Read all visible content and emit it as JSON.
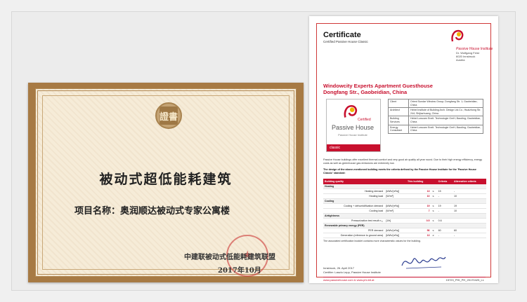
{
  "cn_certificate": {
    "seal_char": "證書",
    "title": "被动式超低能耗建筑",
    "project": "项目名称：奥润顺达被动式专家公寓楼",
    "issuer": "中建联被动式低能耗建筑联盟",
    "date": "2017年10月"
  },
  "ph_certificate": {
    "title": "Certificate",
    "subtitle": "Certified Passive House Classic",
    "institute_name": "Passive House Institute",
    "institute_lines": [
      "Dr. Wolfgang Feist",
      "6020 Innsbruck",
      "Austria"
    ],
    "project_line1": "Windowcity Experts Apartment Guesthouse",
    "project_line2": "Dongfang Str.,  Gaobeidian, China",
    "badge": {
      "certified": "Certified",
      "name": "Passive House",
      "institute": "Passive House Institute",
      "class": "classic"
    },
    "info": [
      {
        "key": "Client",
        "value": "Orient Sundar Window Group; Dongfang Str. 1; Gaobeidian, China"
      },
      {
        "key": "Architect",
        "value": "Hebei Institute of Building Arch. Design Ltd.Co.; Huaizhong Str. 244; Shijiazhuang, China"
      },
      {
        "key": "Building Services",
        "value": "Hebei Lowcarn Enelt. Technologie GmH; Baoding; Gaobeidian, China"
      },
      {
        "key": "Energy Consultant",
        "value": "Hebei Lowcarn Enelt. Technologie GmH; Baoding; Gaobeidian, China"
      }
    ],
    "intro": "Passive House buildings offer excellent thermal comfort and very good air quality all year round. Due to their high energy efficiency, energy costs as well as greenhouse gas emissions are extremely low.",
    "criteria_statement": "The design of the above-mentioned building meets the criteria defined by the Passive House Institute for the 'Passive House Classic' standard:",
    "table": {
      "headers": [
        "Building quality",
        "",
        "This building",
        "",
        "Criteria",
        "Alternative criteria"
      ],
      "rows": [
        {
          "type": "sec",
          "cells": [
            "Heating",
            "",
            "",
            "",
            "",
            ""
          ]
        },
        {
          "type": "row",
          "cells": [
            "Heating demand",
            "[kWh/(m²a)]",
            "13",
            "≤",
            "15",
            "-"
          ]
        },
        {
          "type": "row",
          "cells": [
            "Heating load",
            "[W/m²]",
            "10",
            "≤",
            "-",
            "10"
          ]
        },
        {
          "type": "sec",
          "cells": [
            "Cooling",
            "",
            "",
            "",
            "",
            ""
          ]
        },
        {
          "type": "row",
          "cells": [
            "Cooling + dehumidification demand",
            "[kWh/(m²a)]",
            "19",
            "≤",
            "19",
            "19"
          ]
        },
        {
          "type": "row",
          "cells": [
            "Cooling load",
            "[W/m²]",
            "7",
            "≤",
            "-",
            "10"
          ]
        },
        {
          "type": "sec",
          "cells": [
            "Airtightness",
            "",
            "",
            "",
            "",
            ""
          ]
        },
        {
          "type": "row",
          "cells": [
            "Pressurization test result n₅₀",
            "[1/h]",
            "0.5",
            "≤",
            "0.6",
            ""
          ]
        },
        {
          "type": "sec",
          "cells": [
            "Renewable primary energy (PER)",
            "",
            "",
            "",
            "",
            ""
          ]
        },
        {
          "type": "row",
          "cells": [
            "PER demand",
            "[kWh/(m²a)]",
            "56",
            "≤",
            "60",
            "60"
          ]
        },
        {
          "type": "row",
          "cells": [
            "Generation (reference to ground area)",
            "[kWh/(m²a)]",
            "13",
            "≥",
            "-",
            "-"
          ]
        }
      ]
    },
    "footnote": "The associated certification booklet contains more characteristic values for the building.",
    "sign_place": "Innsbruck, 26. April 2017",
    "sign_name": "Certifier: Laszlo Lepp, Passive House Institute",
    "url": "www.passivehouse.com & www.phi-bit.at",
    "cert_id": "15723_PHI_PH_20170425_LL"
  },
  "colors": {
    "accent": "#c8102e",
    "frame": "#a77a44",
    "paper": "#f6ecd8"
  }
}
